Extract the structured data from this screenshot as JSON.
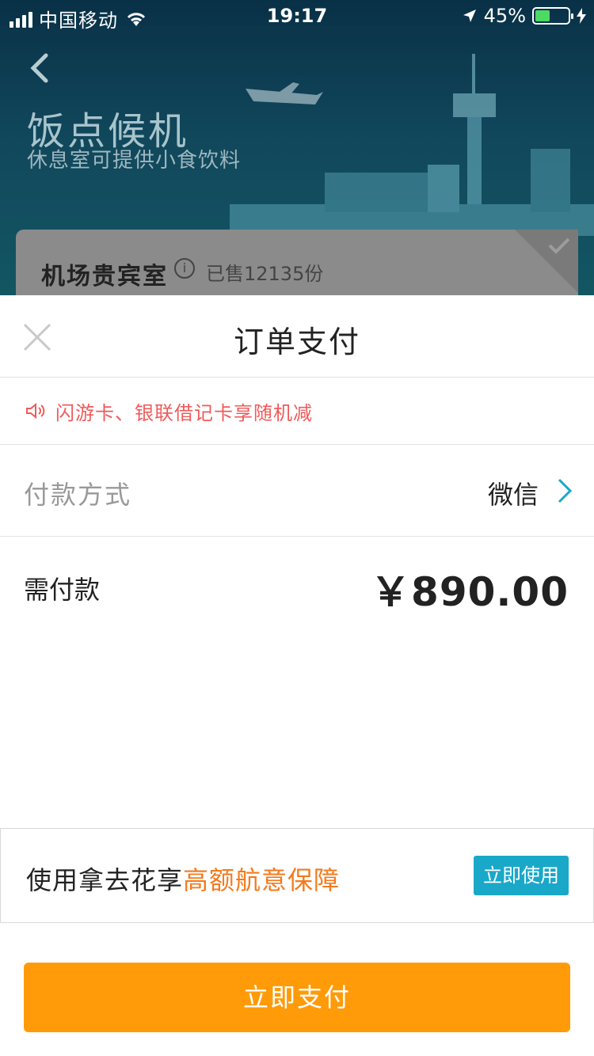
{
  "status_bar": {
    "carrier": "中国移动",
    "time": "19:17",
    "battery": "45%"
  },
  "hero": {
    "title": "饭点候机",
    "subtitle": "休息室可提供小食饮料"
  },
  "product_card": {
    "title": "机场贵宾室",
    "sold": "已售12135份"
  },
  "sheet": {
    "title": "订单支付",
    "promo": "闪游卡、银联借记卡享随机减",
    "payment": {
      "label": "付款方式",
      "value": "微信"
    },
    "amount": {
      "label": "需付款",
      "value": "￥890.00"
    },
    "insurance": {
      "text": "使用拿去花享",
      "highlight": "高额航意保障",
      "button": "立即使用"
    },
    "pay_button": "立即支付"
  },
  "colors": {
    "accent": "#ff9b08",
    "teal": "#1aa8c9",
    "promo_red": "#f05a5a",
    "highlight_orange": "#f47a1e"
  }
}
